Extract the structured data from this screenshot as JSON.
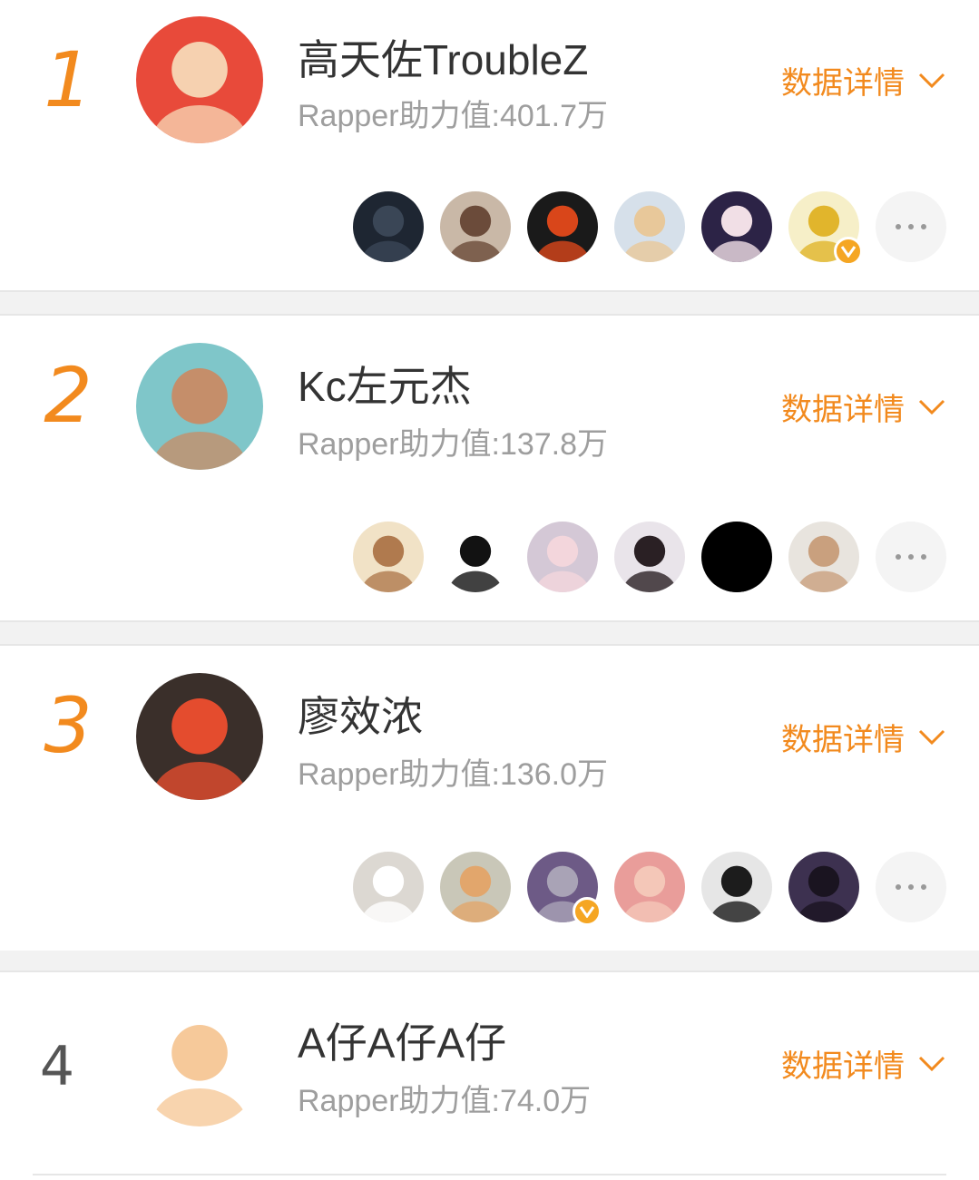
{
  "theme": {
    "accent": "#f28a1e",
    "rank_plain": "#555555",
    "name": "#333333",
    "score": "#9e9e9e",
    "badge": "#f5a623"
  },
  "detail_label": "数据详情",
  "entries": [
    {
      "rank": "1",
      "name": "高天佐TroubleZ",
      "score": "Rapper助力值:401.7万",
      "avatar": {
        "icon": "red-haired-cartoon-avatar",
        "bg": "#e84a3a",
        "fg": "#f6d1b0"
      },
      "fans": [
        {
          "icon": "dark-photo-avatar",
          "bg": "#1e2632",
          "fg": "#3a4656",
          "verified": false
        },
        {
          "icon": "girl-sunglasses-avatar",
          "bg": "#c9b8a7",
          "fg": "#6b4b3a",
          "verified": false
        },
        {
          "icon": "red-flame-avatar",
          "bg": "#1a1a1a",
          "fg": "#d9461a",
          "verified": false
        },
        {
          "icon": "blonde-girl-avatar",
          "bg": "#d6e0ea",
          "fg": "#e8c89a",
          "verified": false
        },
        {
          "icon": "anime-girl-avatar",
          "bg": "#2c2346",
          "fg": "#f1dfe6",
          "verified": false
        },
        {
          "icon": "yellow-hood-cartoon-avatar",
          "bg": "#f6efc8",
          "fg": "#e1b52c",
          "verified": true
        }
      ]
    },
    {
      "rank": "2",
      "name": "Kc左元杰",
      "score": "Rapper助力值:137.8万",
      "avatar": {
        "icon": "man-sunglasses-avatar",
        "bg": "#7fc6c9",
        "fg": "#c58e6a"
      },
      "fans": [
        {
          "icon": "girl-flowers-avatar",
          "bg": "#f1e2c6",
          "fg": "#b07a4e",
          "verified": false
        },
        {
          "icon": "black-gummy-bear-avatar",
          "bg": "#ffffff",
          "fg": "#121212",
          "verified": false
        },
        {
          "icon": "pink-cartoon-pig-avatar",
          "bg": "#d4c8d6",
          "fg": "#f3d6dc",
          "verified": false
        },
        {
          "icon": "girl-long-hair-avatar",
          "bg": "#e9e4ea",
          "fg": "#2a2024",
          "verified": false
        },
        {
          "icon": "black-circle-avatar",
          "bg": "#000000",
          "fg": "#000000",
          "verified": false
        },
        {
          "icon": "baby-beanie-avatar",
          "bg": "#e8e4de",
          "fg": "#c9a07e",
          "verified": false
        }
      ]
    },
    {
      "rank": "3",
      "name": "廖效浓",
      "score": "Rapper助力值:136.0万",
      "avatar": {
        "icon": "psychedelic-spiral-face-avatar",
        "bg": "#3a2f2a",
        "fg": "#e44c2e"
      },
      "fans": [
        {
          "icon": "white-puppy-avatar",
          "bg": "#dcd8d2",
          "fg": "#ffffff",
          "verified": false
        },
        {
          "icon": "orange-kitten-avatar",
          "bg": "#c9c7b8",
          "fg": "#e2a66c",
          "verified": false
        },
        {
          "icon": "tom-cat-cartoon-avatar",
          "bg": "#6d5a86",
          "fg": "#a9a3b6",
          "verified": true
        },
        {
          "icon": "pink-hair-girl-avatar",
          "bg": "#e99d9a",
          "fg": "#f4c7b8",
          "verified": false
        },
        {
          "icon": "mirror-selfie-avatar",
          "bg": "#e6e6e6",
          "fg": "#1c1c1c",
          "verified": false
        },
        {
          "icon": "dark-anime-girl-avatar",
          "bg": "#3d3150",
          "fg": "#1a1420",
          "verified": false
        }
      ]
    },
    {
      "rank": "4",
      "name": "A仔A仔A仔",
      "score": "Rapper助力值:74.0万",
      "avatar": {
        "icon": "cartoon-man-sunglasses-avatar",
        "bg": "#ffffff",
        "fg": "#f6c99a"
      },
      "fans": []
    }
  ]
}
